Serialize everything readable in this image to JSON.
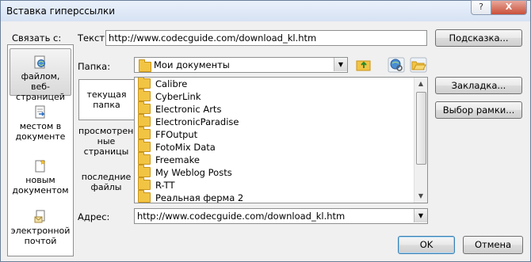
{
  "window": {
    "title": "Вставка гиперссылки",
    "help_label": "?",
    "close_label": "X"
  },
  "link_to": {
    "label": "Связать с:",
    "items": [
      {
        "label_line1": "файлом, веб-",
        "label_line2": "страницей"
      },
      {
        "label_line1": "местом в",
        "label_line2": "документе"
      },
      {
        "label_line1": "новым",
        "label_line2": "документом"
      },
      {
        "label_line1": "электронной",
        "label_line2": "почтой"
      }
    ]
  },
  "text_field": {
    "label": "Текст:",
    "value": "http://www.codecguide.com/download_kl.htm"
  },
  "buttons": {
    "screentip": "Подсказка...",
    "bookmark": "Закладка...",
    "target_frame": "Выбор рамки...",
    "ok": "OK",
    "cancel": "Отмена"
  },
  "folder": {
    "label": "Папка:",
    "value": "Мои документы"
  },
  "sub_items": [
    {
      "line1": "текущая",
      "line2": "папка",
      "line3": ""
    },
    {
      "line1": "просмотрен-",
      "line2": "ные",
      "line3": "страницы"
    },
    {
      "line1": "последние",
      "line2": "файлы",
      "line3": ""
    }
  ],
  "files": [
    "Calibre",
    "CyberLink",
    "Electronic Arts",
    "ElectronicParadise",
    "FFOutput",
    "FotoMix Data",
    "Freemake",
    "My Weblog Posts",
    "R-TT",
    "Реальная ферма 2"
  ],
  "address": {
    "label": "Адрес:",
    "value": "http://www.codecguide.com/download_kl.htm"
  },
  "colors": {
    "title_bg": "#dbe6f4",
    "close_red": "#c9503a",
    "folder_yellow": "#f2c443",
    "ok_border": "#3c7fb1"
  }
}
